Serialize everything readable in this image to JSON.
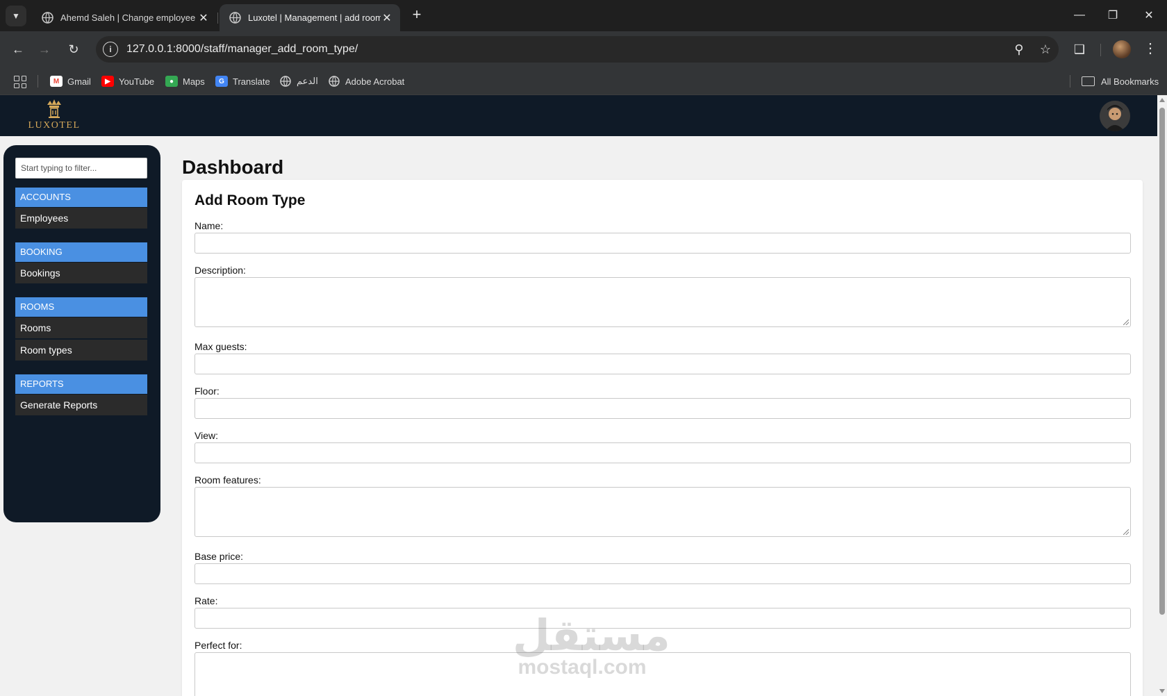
{
  "browser": {
    "tabs": [
      {
        "title": "Ahemd Saleh | Change employee",
        "active": false
      },
      {
        "title": "Luxotel | Management | add room",
        "active": true
      }
    ],
    "url": "127.0.0.1:8000/staff/manager_add_room_type/",
    "bookmarks": [
      {
        "label": "Gmail",
        "icon": "gmail-icon",
        "color": "#ea4335"
      },
      {
        "label": "YouTube",
        "icon": "youtube-icon",
        "color": "#ff0000"
      },
      {
        "label": "Maps",
        "icon": "maps-icon",
        "color": "#34a853"
      },
      {
        "label": "Translate",
        "icon": "translate-icon",
        "color": "#4285f4"
      },
      {
        "label": "الدعم",
        "icon": "globe-icon",
        "color": "#cfcfcf"
      },
      {
        "label": "Adobe Acrobat",
        "icon": "globe-icon",
        "color": "#cfcfcf"
      }
    ],
    "all_bookmarks": "All Bookmarks"
  },
  "site": {
    "logo_text": "LUXOTEL",
    "brand_color": "#d6a95a",
    "header_color": "#0f1a27"
  },
  "sidebar": {
    "filter_placeholder": "Start typing to filter...",
    "sections": [
      {
        "header": "ACCOUNTS",
        "items": [
          "Employees"
        ]
      },
      {
        "header": "BOOKING",
        "items": [
          "Bookings"
        ]
      },
      {
        "header": "ROOMS",
        "items": [
          "Rooms",
          "Room types"
        ]
      },
      {
        "header": "REPORTS",
        "items": [
          "Generate Reports"
        ]
      }
    ],
    "accent_color": "#4a90e2"
  },
  "main": {
    "title": "Dashboard",
    "form": {
      "title": "Add Room Type",
      "fields": [
        {
          "label": "Name:",
          "type": "input",
          "value": ""
        },
        {
          "label": "Description:",
          "type": "textarea",
          "value": ""
        },
        {
          "label": "Max guests:",
          "type": "input",
          "value": ""
        },
        {
          "label": "Floor:",
          "type": "input",
          "value": ""
        },
        {
          "label": "View:",
          "type": "input",
          "value": ""
        },
        {
          "label": "Room features:",
          "type": "textarea",
          "value": ""
        },
        {
          "label": "Base price:",
          "type": "input",
          "value": ""
        },
        {
          "label": "Rate:",
          "type": "input",
          "value": ""
        },
        {
          "label": "Perfect for:",
          "type": "textarea",
          "value": ""
        }
      ]
    }
  },
  "watermark": {
    "arabic": "مستقل",
    "latin": "mostaql.com"
  }
}
